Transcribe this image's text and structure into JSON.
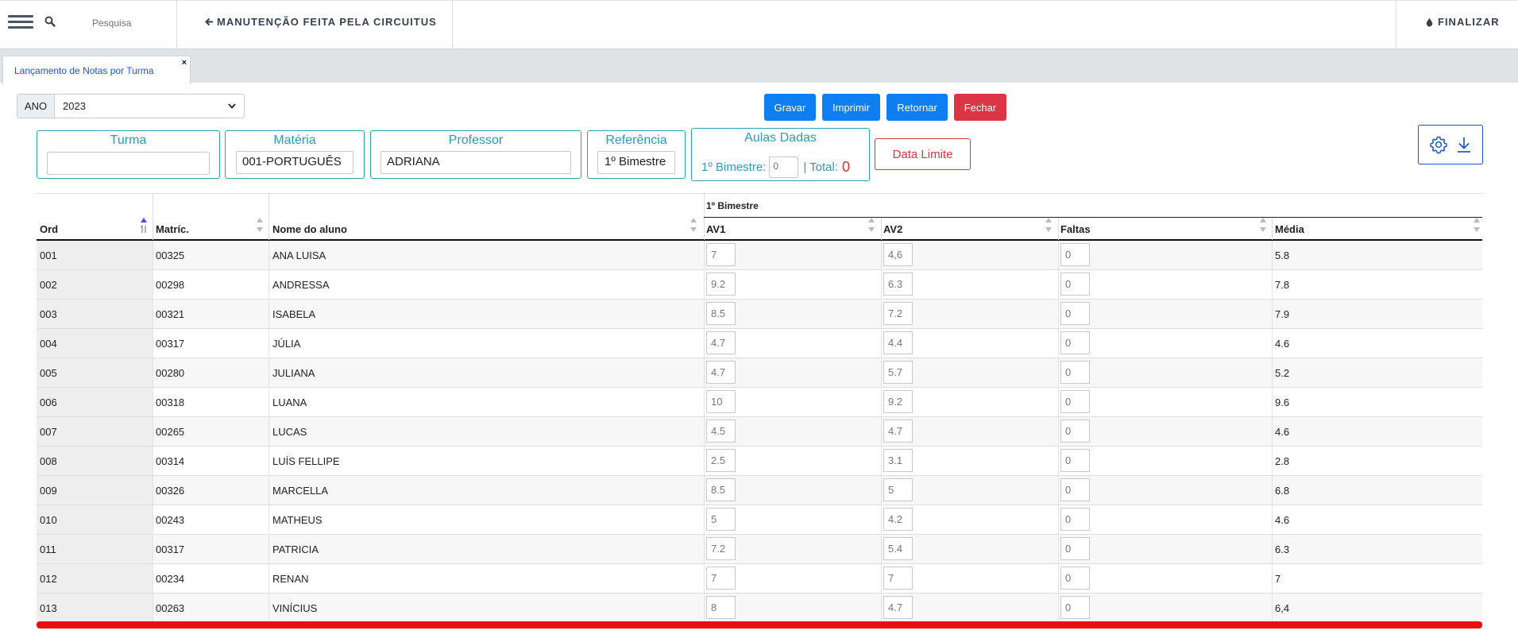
{
  "topbar": {
    "search_label": "Pesquisa",
    "back_label": "MANUTENÇÃO FEITA PELA CIRCUITUS",
    "finalize_label": "FINALIZAR",
    "icons": [
      "menu-icon",
      "search-icon",
      "arrow-left-icon",
      "drop-icon"
    ]
  },
  "tab": {
    "label": "Lançamento de Notas por Turma",
    "close": "×"
  },
  "filters": {
    "ano_label": "ANO",
    "ano_value": "2023",
    "turma_label": "Turma",
    "turma_value": "",
    "materia_label": "Matéria",
    "materia_value": "001-PORTUGUÊS",
    "professor_label": "Professor",
    "professor_value": "ADRIANA",
    "referencia_label": "Referência",
    "referencia_value": "1º Bimestre",
    "aulas_label": "Aulas Dadas",
    "aulas_bimestre_label": "1º Bimestre:",
    "aulas_bimestre_value": "0",
    "aulas_total_label": "| Total:",
    "aulas_total_value": "0",
    "data_limite_label": "Data Limite"
  },
  "actions": {
    "gravar": "Gravar",
    "imprimir": "Imprimir",
    "retornar": "Retornar",
    "fechar": "Fechar"
  },
  "colors": {
    "primary": "#0d7ff2",
    "danger": "#dc3545",
    "teal": "#2aa8a8",
    "accent_red": "#e80f0f"
  },
  "table": {
    "group_label": "1º Bimestre",
    "headers": {
      "ord": "Ord",
      "matric": "Matríc.",
      "nome": "Nome do aluno",
      "av1": "AV1",
      "av2": "AV2",
      "faltas": "Faltas",
      "media": "Média"
    },
    "rows": [
      {
        "ord": "001",
        "matric": "00325",
        "nome": "ANA LUISA",
        "av1": "7",
        "av2": "4,6",
        "faltas": "0",
        "media": "5.8"
      },
      {
        "ord": "002",
        "matric": "00298",
        "nome": "ANDRESSA",
        "av1": "9.2",
        "av2": "6.3",
        "faltas": "0",
        "media": "7.8"
      },
      {
        "ord": "003",
        "matric": "00321",
        "nome": "ISABELA",
        "av1": "8.5",
        "av2": "7.2",
        "faltas": "0",
        "media": "7.9"
      },
      {
        "ord": "004",
        "matric": "00317",
        "nome": "JÚLIA",
        "av1": "4.7",
        "av2": "4.4",
        "faltas": "0",
        "media": "4.6"
      },
      {
        "ord": "005",
        "matric": "00280",
        "nome": "JULIANA",
        "av1": "4.7",
        "av2": "5.7",
        "faltas": "0",
        "media": "5.2"
      },
      {
        "ord": "006",
        "matric": "00318",
        "nome": "LUANA",
        "av1": "10",
        "av2": "9.2",
        "faltas": "0",
        "media": "9.6"
      },
      {
        "ord": "007",
        "matric": "00265",
        "nome": "LUCAS",
        "av1": "4.5",
        "av2": "4.7",
        "faltas": "0",
        "media": "4.6"
      },
      {
        "ord": "008",
        "matric": "00314",
        "nome": "LUÍS FELLIPE",
        "av1": "2.5",
        "av2": "3.1",
        "faltas": "0",
        "media": "2.8"
      },
      {
        "ord": "009",
        "matric": "00326",
        "nome": "MARCELLA",
        "av1": "8.5",
        "av2": "5",
        "faltas": "0",
        "media": "6.8"
      },
      {
        "ord": "010",
        "matric": "00243",
        "nome": "MATHEUS",
        "av1": "5",
        "av2": "4.2",
        "faltas": "0",
        "media": "4.6"
      },
      {
        "ord": "011",
        "matric": "00317",
        "nome": "PATRICIA",
        "av1": "7.2",
        "av2": "5.4",
        "faltas": "0",
        "media": "6.3"
      },
      {
        "ord": "012",
        "matric": "00234",
        "nome": "RENAN",
        "av1": "7",
        "av2": "7",
        "faltas": "0",
        "media": "7"
      },
      {
        "ord": "013",
        "matric": "00263",
        "nome": "VINÍCIUS",
        "av1": "8",
        "av2": "4.7",
        "faltas": "0",
        "media": "6,4"
      }
    ]
  }
}
